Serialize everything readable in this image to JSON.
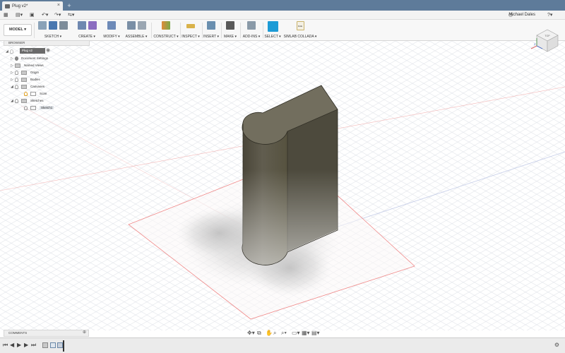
{
  "tab": {
    "title": "Plug v2*"
  },
  "user": {
    "name": "Michael Dales"
  },
  "ribbon": {
    "workspace": "MODEL ▾",
    "groups": [
      {
        "label": "SKETCH ▾"
      },
      {
        "label": "CREATE ▾"
      },
      {
        "label": "MODIFY ▾"
      },
      {
        "label": "ASSEMBLE ▾"
      },
      {
        "label": "CONSTRUCT ▾"
      },
      {
        "label": "INSPECT ▾"
      },
      {
        "label": "INSERT ▾"
      },
      {
        "label": "MAKE ▾"
      },
      {
        "label": "ADD-INS ▾"
      },
      {
        "label": "SELECT ▾"
      },
      {
        "label": "SIMLAB COLLADA ▾"
      }
    ],
    "dae_label": "DAE"
  },
  "browser": {
    "title": "BROWSER",
    "document": "Plug v2",
    "items": [
      {
        "label": "Document Settings"
      },
      {
        "label": "Named Views"
      },
      {
        "label": "Origin"
      },
      {
        "label": "Bodies"
      },
      {
        "label": "Canvases"
      },
      {
        "label": "Scan"
      },
      {
        "label": "Sketches"
      },
      {
        "label": "Sketch1"
      }
    ]
  },
  "viewcube": {
    "top": "TOP",
    "x": "X",
    "y": "Y",
    "z": "Z"
  },
  "comments": {
    "title": "COMMENTS"
  },
  "colors": {
    "titlebar": "#5e7b9a",
    "body": "#5a5749",
    "select_accent": "#1d9bd6"
  }
}
